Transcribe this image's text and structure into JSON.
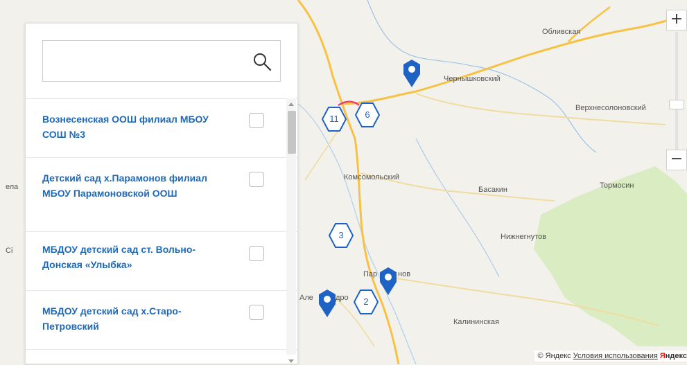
{
  "map": {
    "places": [
      {
        "label": "Обливская"
      },
      {
        "label": "Чернышковский"
      },
      {
        "label": "Верхнесолоновский"
      },
      {
        "label": "Комсомольский"
      },
      {
        "label": "Басакин"
      },
      {
        "label": "Тормосин"
      },
      {
        "label": "Нижнегнутов"
      },
      {
        "label": "Пар"
      },
      {
        "label": "нов"
      },
      {
        "label": "Але"
      },
      {
        "label": "дро"
      },
      {
        "label": "Калининская"
      },
      {
        "label": "ела"
      },
      {
        "label": "Сі"
      }
    ],
    "clusters": [
      {
        "count": "11"
      },
      {
        "count": "6"
      },
      {
        "count": "3"
      },
      {
        "count": "2"
      }
    ],
    "pins": [
      "map-pin",
      "map-pin",
      "map-pin"
    ],
    "zoom": {
      "in": "+",
      "out": "−"
    },
    "copyright": {
      "text": "© Яндекс",
      "terms": "Условия использования",
      "brand_colored": "Я",
      "brand_rest": "ндекс"
    }
  },
  "sidebar": {
    "search": {
      "value": "",
      "placeholder": "",
      "icon": "search-icon"
    },
    "items": [
      {
        "name": "Вознесенская ООШ филиал МБОУ СОШ №3",
        "checked": false
      },
      {
        "name": "Детский сад х.Парамонов филиал МБОУ Парамоновской ООШ",
        "checked": false
      },
      {
        "name": "МБДОУ детский сад ст. Вольно-Донская «Улыбка»",
        "checked": false
      },
      {
        "name": "МБДОУ детский сад х.Старо-Петровский",
        "checked": false
      }
    ]
  },
  "colors": {
    "accent": "#1e69b8",
    "marker": "#1e63c4",
    "land": "#f3f1ec",
    "forest": "#d9ecc2",
    "road_major": "#f7c244",
    "road_minor": "#f0dca0",
    "river": "#9dc4e6"
  }
}
